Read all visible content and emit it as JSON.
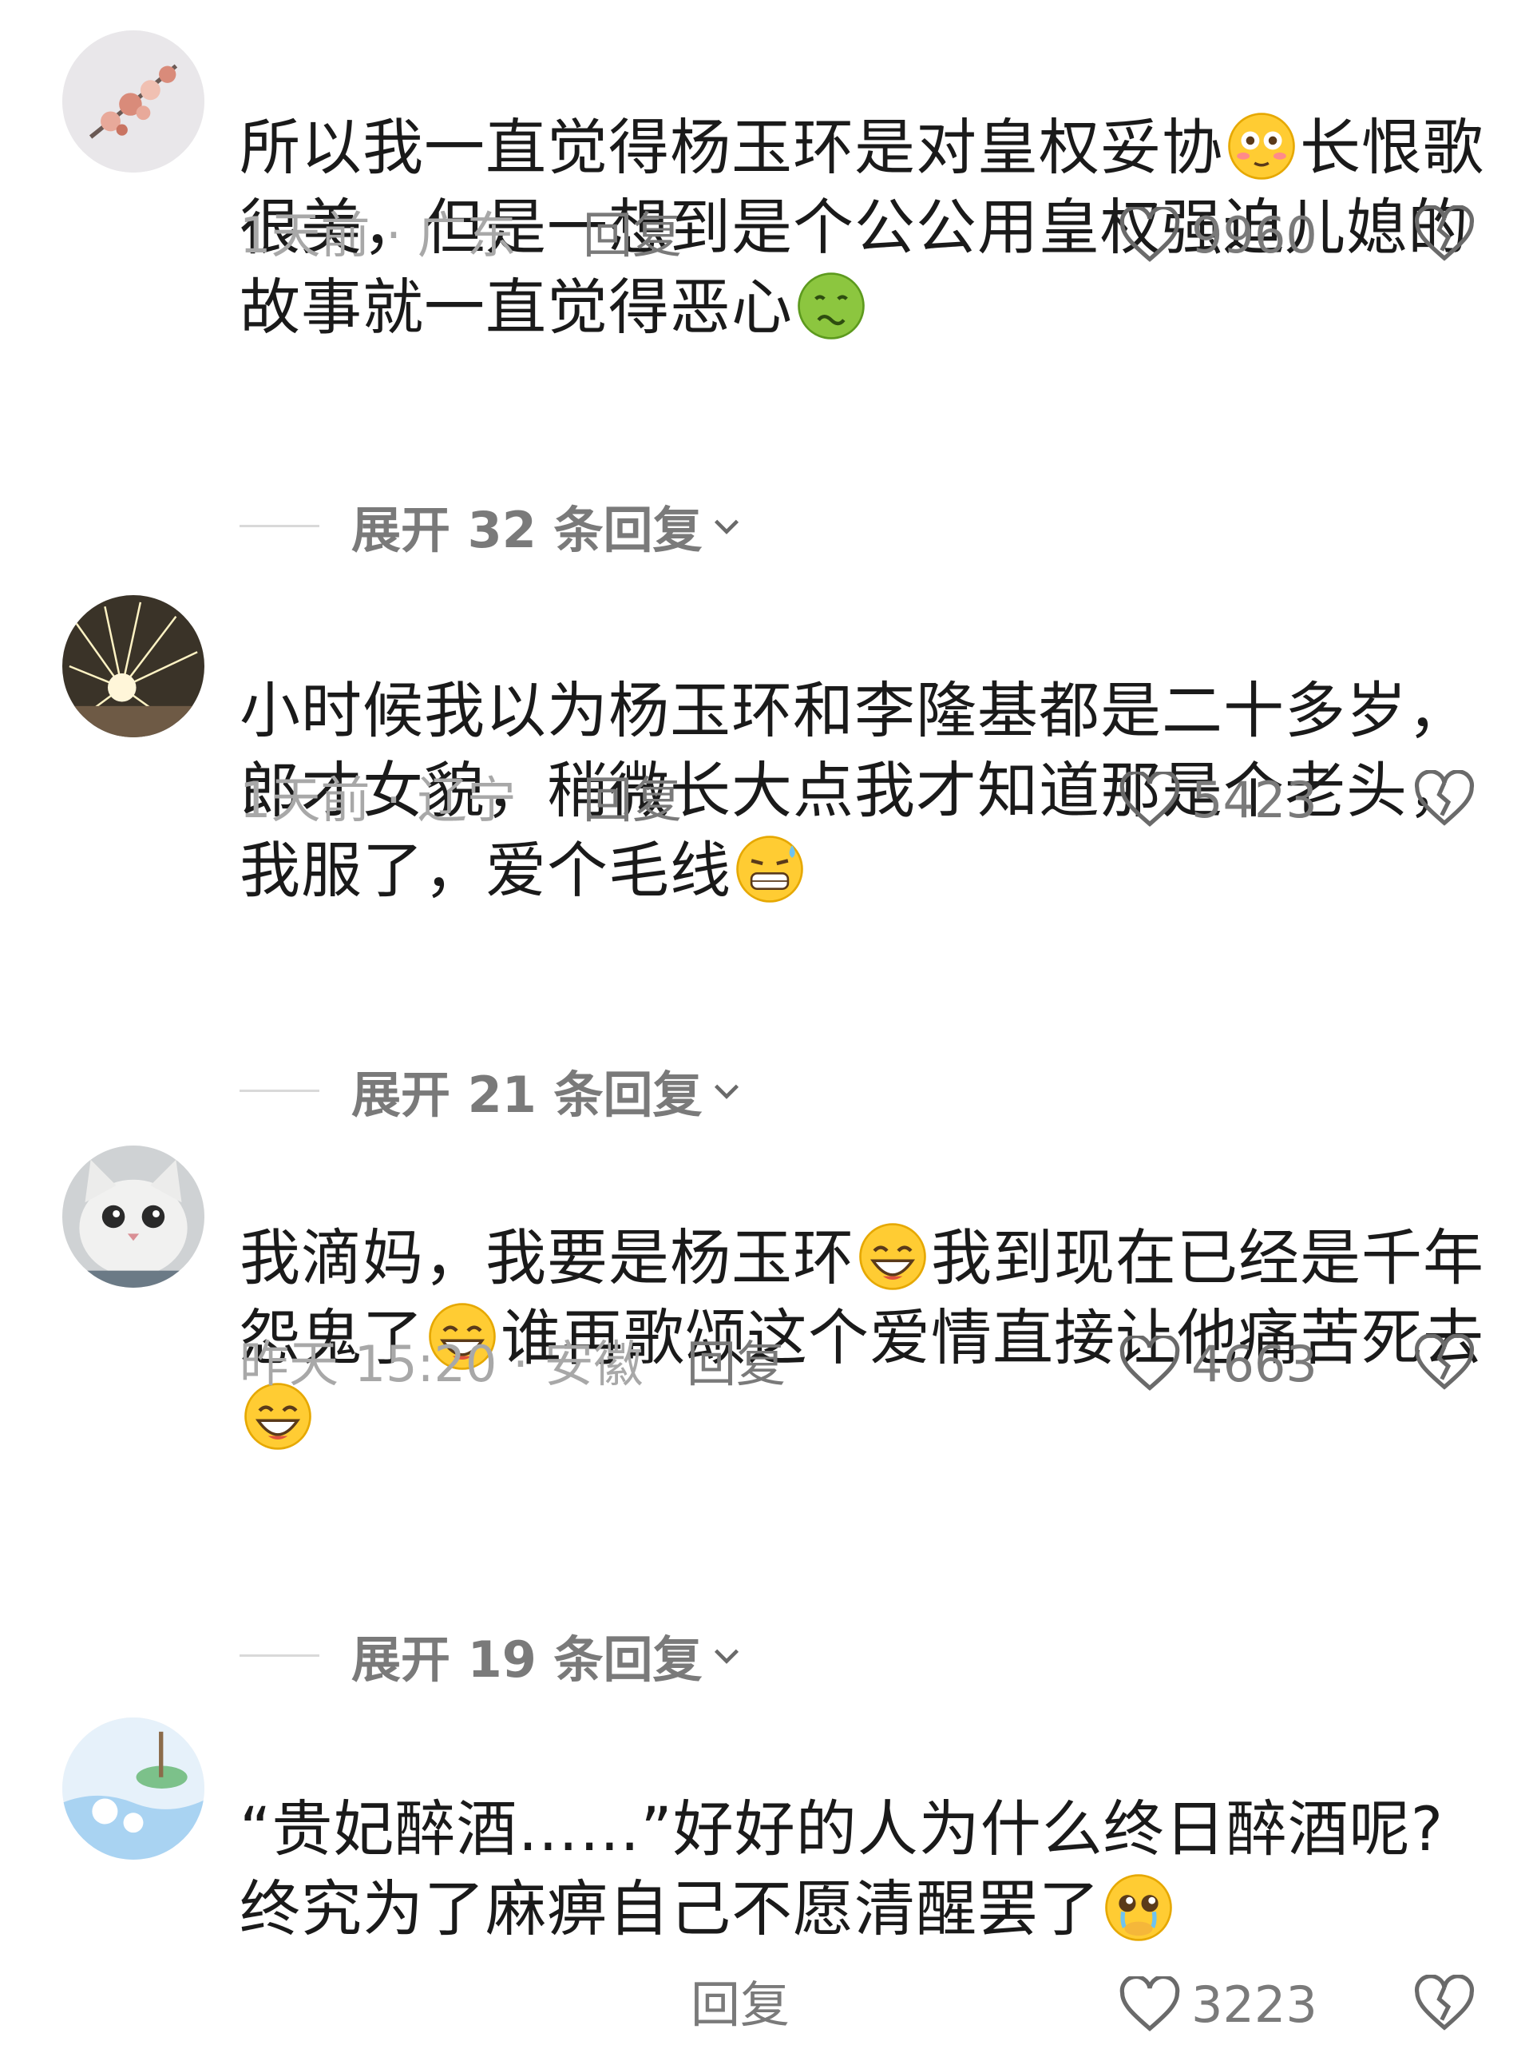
{
  "comments": [
    {
      "text_parts": [
        "所以我一直觉得杨玉环是对皇权妥协",
        "长恨歌很美，但是一想到是个公公用皇权强迫儿媳的故事就一直觉得恶心"
      ],
      "emojis": [
        "flushed-emoji",
        "nauseated-emoji"
      ],
      "time": "1天前 · 广东",
      "reply_label": "回复",
      "likes": "9960",
      "expand_label": "展开 32 条回复"
    },
    {
      "text_parts": [
        "小时候我以为杨玉环和李隆基都是二十多岁，郎才女貌，稍微长大点我才知道那是个老头，我服了，爱个毛线"
      ],
      "emojis": [
        "grimace-sweat-emoji"
      ],
      "time": "1天前 · 辽宁",
      "reply_label": "回复",
      "likes": "5423",
      "expand_label": "展开 21 条回复"
    },
    {
      "text_parts": [
        "我滴妈，我要是杨玉环",
        "我到现在已经是千年怨鬼了",
        "谁再歌颂这个爱情直接让他痛苦死去"
      ],
      "emojis": [
        "grinning-emoji",
        "grinning-emoji",
        "grinning-emoji"
      ],
      "time": "昨天 15:20 · 安徽",
      "reply_label": "回复",
      "likes": "4663",
      "expand_label": "展开 19 条回复"
    },
    {
      "text_parts": [
        "“贵妃醉酒……”好好的人为什么终日醉酒呢?终究为了麻痹自己不愿清醒罢了"
      ],
      "emojis": [
        "pleading-tears-emoji"
      ],
      "time": "",
      "reply_label": "回复",
      "likes": "3223"
    }
  ]
}
